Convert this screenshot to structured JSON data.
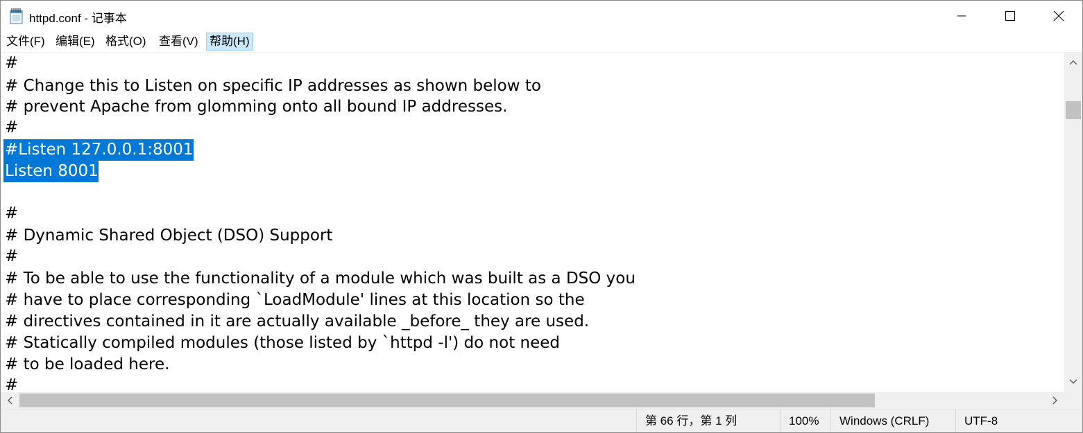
{
  "window": {
    "title": "httpd.conf - 记事本",
    "app_icon": "notepad-icon",
    "controls": [
      "minimize-icon",
      "maximize-icon",
      "close-icon"
    ]
  },
  "menu": {
    "file": "文件(F)",
    "edit": "编辑(E)",
    "format": "格式(O)",
    "view": "查看(V)",
    "help": "帮助(H)"
  },
  "editor": {
    "lines": [
      "#",
      "# Change this to Listen on specific IP addresses as shown below to",
      "# prevent Apache from glomming onto all bound IP addresses.",
      "#",
      "#Listen 127.0.0.1:8001",
      "Listen 8001",
      "",
      "#",
      "# Dynamic Shared Object (DSO) Support",
      "#",
      "# To be able to use the functionality of a module which was built as a DSO you",
      "# have to place corresponding `LoadModule' lines at this location so the",
      "# directives contained in it are actually available _before_ they are used.",
      "# Statically compiled modules (those listed by `httpd -l') do not need",
      "# to be loaded here.",
      "#"
    ],
    "selected_lines": [
      4,
      5
    ],
    "selection_color": "#0078d7"
  },
  "status": {
    "position": "第 66 行，第 1 列",
    "zoom": "100%",
    "line_ending": "Windows (CRLF)",
    "encoding": "UTF-8"
  },
  "colors": {
    "menu_active_bg": "#cce8ff",
    "statusbar_bg": "#f0f0f0",
    "scrollbar_thumb": "#c2c2c2"
  }
}
